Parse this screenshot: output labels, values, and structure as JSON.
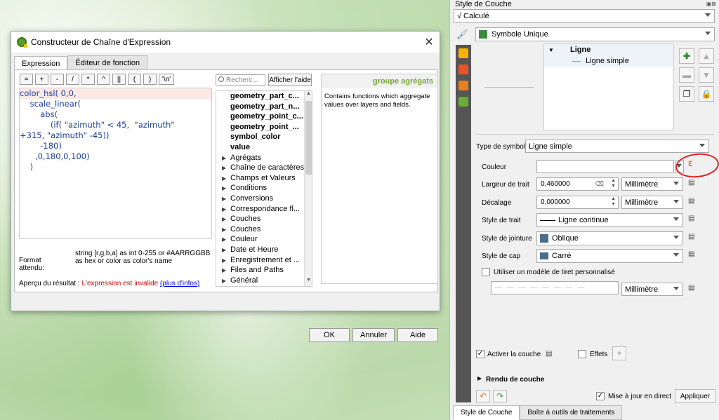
{
  "dialog": {
    "title": "Constructeur de Chaîne d'Expression",
    "tabs": [
      "Expression",
      "Éditeur de fonction"
    ],
    "operators": [
      "=",
      "+",
      "-",
      "/",
      "*",
      "^",
      "||",
      "(",
      ")",
      "'\\n'"
    ],
    "editor_lines": [
      "color_hsl( 0,0,",
      "    scale_linear(",
      "        abs(",
      "            (if( \"azimuth\" < 45,  \"azimuth\"",
      "+315, \"azimuth\" -45))",
      "        -180)",
      "      ,0,180,0,100)",
      "    )"
    ],
    "format_label": "Format attendu:",
    "format_text": "string [r,g,b,a] as int 0-255 or #AARRGGBB as hex or color as color's name",
    "preview_label": "Aperçu du résultat :",
    "preview_error": "L'expression est invalide",
    "preview_link": "(plus d'infos)",
    "search_placeholder": "Recherc...",
    "help_button": "Afficher l'aide",
    "function_items": [
      {
        "label": "geometry_part_c...",
        "bold": true,
        "group": false
      },
      {
        "label": "geometry_part_n...",
        "bold": true,
        "group": false
      },
      {
        "label": "geometry_point_c...",
        "bold": true,
        "group": false
      },
      {
        "label": "geometry_point_...",
        "bold": true,
        "group": false
      },
      {
        "label": "symbol_color",
        "bold": true,
        "group": false
      },
      {
        "label": "value",
        "bold": true,
        "group": false
      },
      {
        "label": "Agrégats",
        "bold": false,
        "group": true
      },
      {
        "label": "Chaîne de caractères",
        "bold": false,
        "group": true
      },
      {
        "label": "Champs et Valeurs",
        "bold": false,
        "group": true
      },
      {
        "label": "Conditions",
        "bold": false,
        "group": true
      },
      {
        "label": "Conversions",
        "bold": false,
        "group": true
      },
      {
        "label": "Correspondance fl...",
        "bold": false,
        "group": true
      },
      {
        "label": "Couches",
        "bold": false,
        "group": true
      },
      {
        "label": "Couches",
        "bold": false,
        "group": true
      },
      {
        "label": "Couleur",
        "bold": false,
        "group": true
      },
      {
        "label": "Date et Heure",
        "bold": false,
        "group": true
      },
      {
        "label": "Enregistrement et ...",
        "bold": false,
        "group": true
      },
      {
        "label": "Files and Paths",
        "bold": false,
        "group": true
      },
      {
        "label": "Général",
        "bold": false,
        "group": true
      }
    ],
    "help_panel_title": "groupe agrégats",
    "help_panel_text": "Contains functions which aggregate values over layers and fields.",
    "buttons": {
      "ok": "OK",
      "cancel": "Annuler",
      "help": "Aide"
    }
  },
  "panel": {
    "title": "Style de Couche",
    "renderer_mode": "Calculé",
    "symbol_type": "Symbole Unique",
    "tree": {
      "root": "Ligne",
      "child": "Ligne simple"
    },
    "symbol_type_label": "Type de symbole",
    "symbol_type_value": "Ligne simple",
    "color_label": "Couleur",
    "width_label": "Largeur de trait",
    "width_value": "0,460000",
    "width_unit": "Millimètre",
    "offset_label": "Décalage",
    "offset_value": "0,000000",
    "offset_unit": "Millimètre",
    "stroke_style_label": "Style de trait",
    "stroke_style_value": "Ligne continue",
    "join_style_label": "Style de jointure",
    "join_style_value": "Oblique",
    "cap_style_label": "Style de cap",
    "cap_style_value": "Carré",
    "custom_dash_label": "Utiliser un modèle de tiret personnalisé",
    "dash_unit": "Millimètre",
    "enable_layer_label": "Activer la couche",
    "effects_label": "Effets",
    "layer_rendering_label": "Rendu de couche",
    "live_update_label": "Mise à jour en direct",
    "apply_button": "Appliquer",
    "bottom_tabs": [
      "Style de Couche",
      "Boîte à outils de traitements"
    ]
  }
}
